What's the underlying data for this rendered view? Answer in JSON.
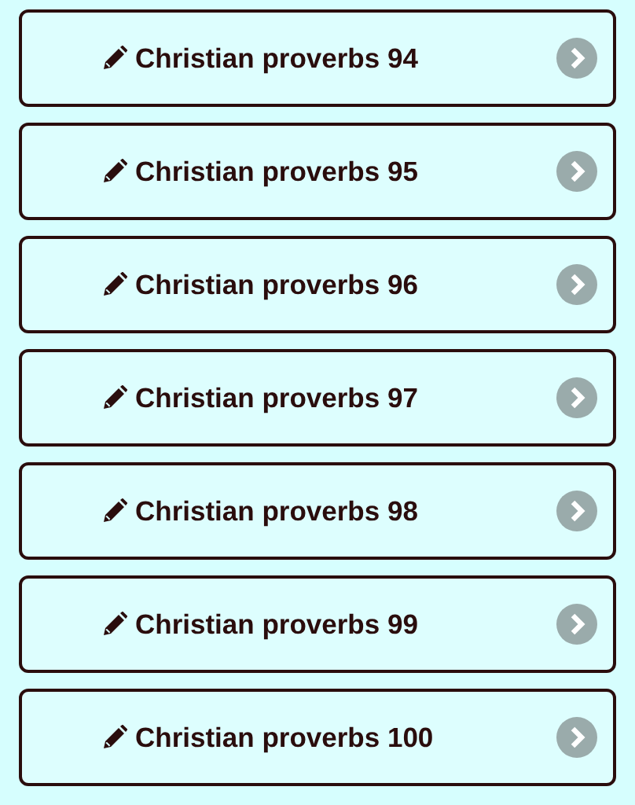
{
  "items": [
    {
      "label": "Christian proverbs 94"
    },
    {
      "label": "Christian proverbs 95"
    },
    {
      "label": "Christian proverbs 96"
    },
    {
      "label": "Christian proverbs 97"
    },
    {
      "label": "Christian proverbs 98"
    },
    {
      "label": "Christian proverbs 99"
    },
    {
      "label": "Christian proverbs 100"
    }
  ]
}
